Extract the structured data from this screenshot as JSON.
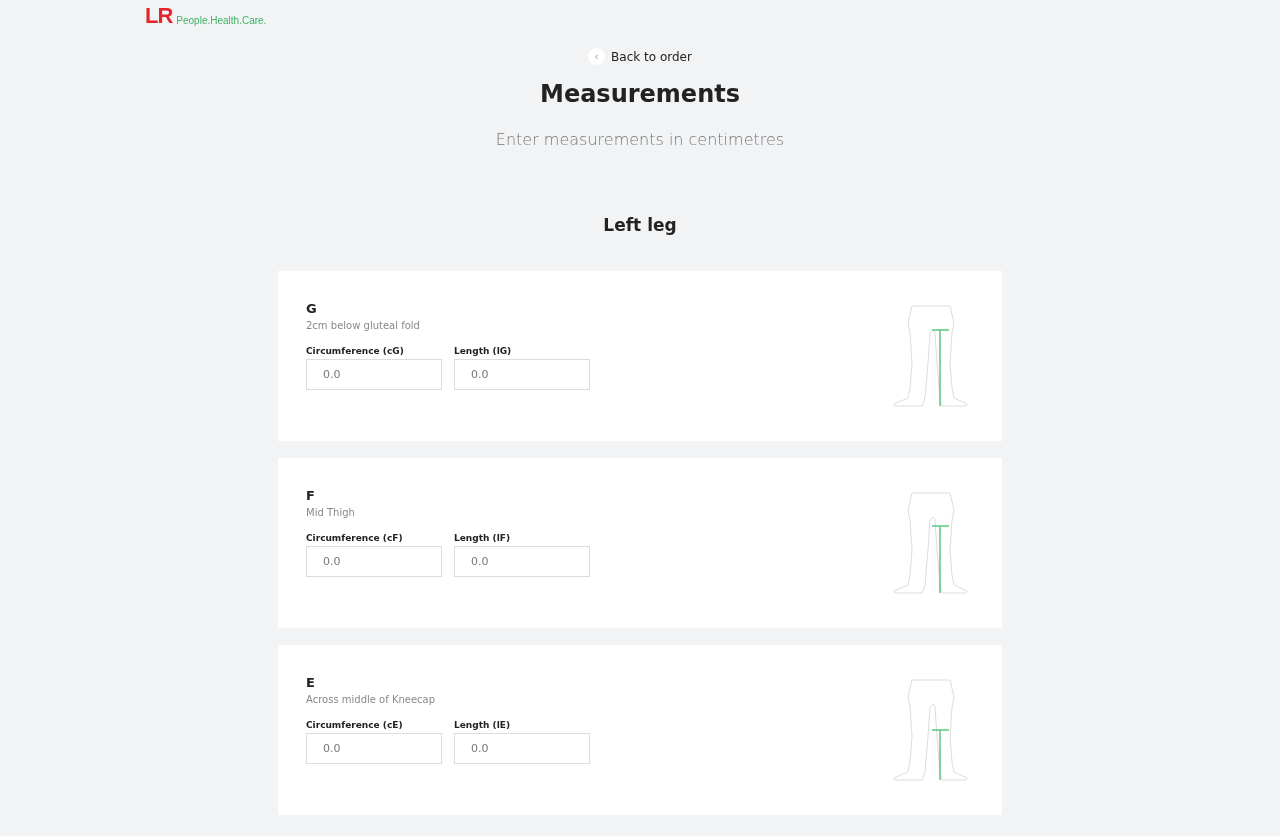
{
  "logo": {
    "mark": "LR",
    "tagline": "People.Health.Care."
  },
  "back_link": {
    "icon": "‹",
    "label": "Back to order"
  },
  "title": "Measurements",
  "subtitle": "Enter measurements in centimetres",
  "section_title": "Left leg",
  "cards": [
    {
      "letter": "G",
      "description": "2cm below gluteal fold",
      "kind": "upper-thigh",
      "fields": [
        {
          "label": "Circumference (cG)",
          "placeholder": "0.0"
        },
        {
          "label": "Length (lG)",
          "placeholder": "0.0"
        }
      ]
    },
    {
      "letter": "F",
      "description": "Mid Thigh",
      "kind": "mid-thigh",
      "fields": [
        {
          "label": "Circumference (cF)",
          "placeholder": "0.0"
        },
        {
          "label": "Length (lF)",
          "placeholder": "0.0"
        }
      ]
    },
    {
      "letter": "E",
      "description": "Across middle of Kneecap",
      "kind": "knee",
      "fields": [
        {
          "label": "Circumference (cE)",
          "placeholder": "0.0"
        },
        {
          "label": "Length (lE)",
          "placeholder": "0.0"
        }
      ]
    }
  ]
}
